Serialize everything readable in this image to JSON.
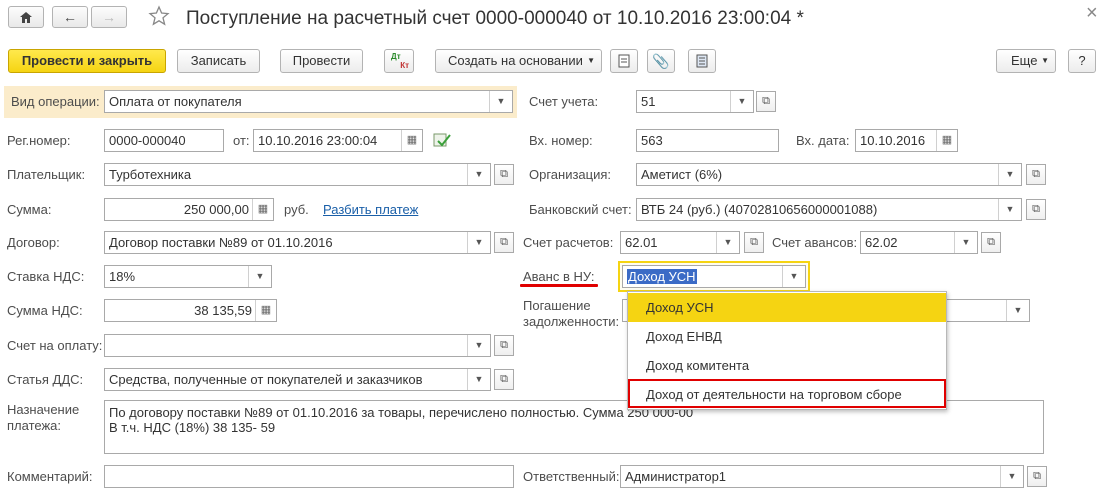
{
  "window": {
    "title": "Поступление на расчетный счет 0000-000040 от 10.10.2016 23:00:04 *",
    "close_glyph": "×"
  },
  "toolbar": {
    "post_and_close": "Провести и закрыть",
    "save": "Записать",
    "post": "Провести",
    "dt_kt_top": "Дт",
    "dt_kt_bottom": "Кт",
    "create_based_on": "Создать на основании",
    "more": "Еще",
    "help": "?"
  },
  "form": {
    "operation_type": {
      "label": "Вид операции:",
      "value": "Оплата от покупателя"
    },
    "reg_number": {
      "label": "Рег.номер:",
      "value": "0000-000040"
    },
    "from": {
      "label": "от:",
      "value": "10.10.2016 23:00:04"
    },
    "payer": {
      "label": "Плательщик:",
      "value": "Турботехника"
    },
    "amount": {
      "label": "Сумма:",
      "value": "250 000,00",
      "currency": "руб.",
      "split_link": "Разбить платеж"
    },
    "contract": {
      "label": "Договор:",
      "value": "Договор поставки №89 от 01.10.2016"
    },
    "vat_rate": {
      "label": "Ставка НДС:",
      "value": "18%"
    },
    "vat_amount": {
      "label": "Сумма НДС:",
      "value": "38 135,59"
    },
    "invoice": {
      "label": "Счет на оплату:",
      "value": ""
    },
    "cash_flow_item": {
      "label": "Статья ДДС:",
      "value": "Средства, полученные от покупателей и заказчиков"
    },
    "purpose": {
      "label_line1": "Назначение",
      "label_line2": "платежа:",
      "line1": "По договору поставки №89 от 01.10.2016 за товары, перечислено полностью. Сумма 250 000-00",
      "line2": "В т.ч. НДС  (18%) 38 135- 59"
    },
    "comment": {
      "label": "Комментарий:",
      "value": ""
    },
    "account": {
      "label": "Счет учета:",
      "value": "51"
    },
    "in_number": {
      "label": "Вх. номер:",
      "value": "563"
    },
    "in_date": {
      "label": "Вх. дата:",
      "value": "10.10.2016"
    },
    "organization": {
      "label": "Организация:",
      "value": "Аметист (6%)"
    },
    "bank_account": {
      "label": "Банковский счет:",
      "value": "ВТБ 24 (руб.) (40702810656000001088)"
    },
    "settlement_account": {
      "label": "Счет расчетов:",
      "value": "62.01"
    },
    "advance_account": {
      "label": "Счет авансов:",
      "value": "62.02"
    },
    "advance_nu": {
      "label": "Аванс в НУ:",
      "value": "Доход УСН"
    },
    "debt_repayment": {
      "label_line1": "Погашение",
      "label_line2": "задолженности:",
      "value": ""
    },
    "responsible": {
      "label": "Ответственный:",
      "value": "Администратор1"
    }
  },
  "dropdown": {
    "items": [
      {
        "label": "Доход УСН"
      },
      {
        "label": "Доход ЕНВД"
      },
      {
        "label": "Доход комитента"
      },
      {
        "label": "Доход от деятельности на торговом сборе"
      }
    ]
  },
  "colors": {
    "primary_button": "#f5d412",
    "highlight_row": "#f5d412",
    "annotation_red": "#e00000",
    "link": "#1a5fa8",
    "operation_bg": "#fbeccb"
  }
}
